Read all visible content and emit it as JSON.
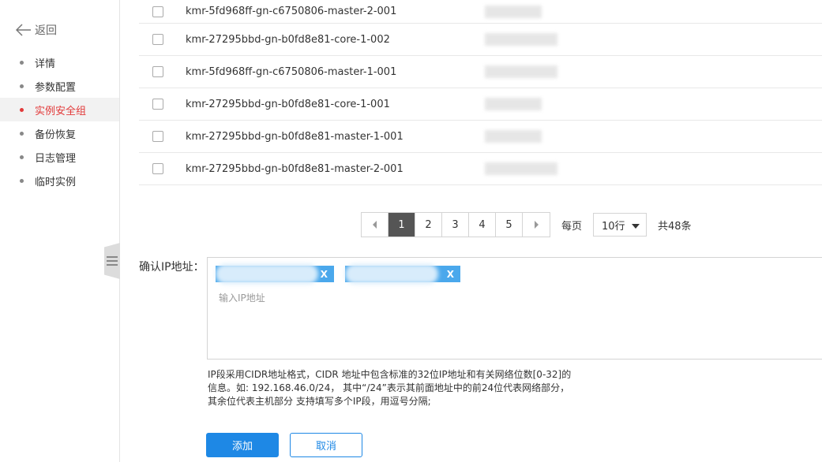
{
  "sidebar": {
    "back_label": "返回",
    "items": [
      {
        "label": "详情"
      },
      {
        "label": "参数配置"
      },
      {
        "label": "实例安全组"
      },
      {
        "label": "备份恢复"
      },
      {
        "label": "日志管理"
      },
      {
        "label": "临时实例"
      }
    ]
  },
  "table": {
    "rows": [
      {
        "name": "kmr-5fd968ff-gn-c6750806-master-2-001"
      },
      {
        "name": "kmr-27295bbd-gn-b0fd8e81-core-1-002"
      },
      {
        "name": "kmr-5fd968ff-gn-c6750806-master-1-001"
      },
      {
        "name": "kmr-27295bbd-gn-b0fd8e81-core-1-001"
      },
      {
        "name": "kmr-27295bbd-gn-b0fd8e81-master-1-001"
      },
      {
        "name": "kmr-27295bbd-gn-b0fd8e81-master-2-001"
      }
    ]
  },
  "pagination": {
    "pages": [
      "1",
      "2",
      "3",
      "4",
      "5"
    ],
    "current": "1",
    "per_page_label": "每页",
    "per_page_value": "10行",
    "total": "共48条"
  },
  "ip_form": {
    "label": "确认IP地址：",
    "tags": [
      {
        "remove_label": "X"
      },
      {
        "remove_label": "X"
      }
    ],
    "placeholder": "输入IP地址",
    "hint": "IP段采用CIDR地址格式，CIDR 地址中包含标准的32位IP地址和有关网络位数[0-32]的信息。如: 192.168.46.0/24， 其中“/24”表示其前面地址中的前24位代表网络部分，其余位代表主机部分 支持填写多个IP段，用逗号分隔;"
  },
  "actions": {
    "add_label": "添加",
    "cancel_label": "取消"
  },
  "colors": {
    "accent": "#1e88e5",
    "active_menu": "#e23a3a",
    "tag": "#4aa8ec",
    "pager_active": "#555555"
  }
}
